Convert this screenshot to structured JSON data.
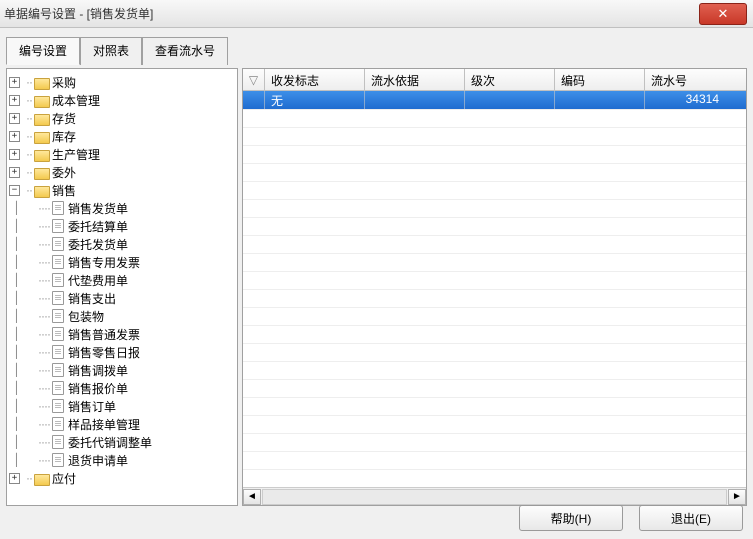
{
  "window": {
    "title": "单据编号设置 - [销售发货单]",
    "close_symbol": "✕"
  },
  "tabs": [
    {
      "label": "编号设置",
      "active": true
    },
    {
      "label": "对照表",
      "active": false
    },
    {
      "label": "查看流水号",
      "active": false
    }
  ],
  "tree": {
    "folders": [
      {
        "label": "采购",
        "expanded": false
      },
      {
        "label": "成本管理",
        "expanded": false
      },
      {
        "label": "存货",
        "expanded": false
      },
      {
        "label": "库存",
        "expanded": false
      },
      {
        "label": "生产管理",
        "expanded": false
      },
      {
        "label": "委外",
        "expanded": false
      },
      {
        "label": "销售",
        "expanded": true
      },
      {
        "label": "应付",
        "expanded": false
      }
    ],
    "sales_children": [
      "销售发货单",
      "委托结算单",
      "委托发货单",
      "销售专用发票",
      "代垫费用单",
      "销售支出",
      "包装物",
      "销售普通发票",
      "销售零售日报",
      "销售调拨单",
      "销售报价单",
      "销售订单",
      "样品接单管理",
      "委托代销调整单",
      "退货申请单"
    ]
  },
  "grid": {
    "columns": [
      "收发标志",
      "流水依据",
      "级次",
      "编码",
      "流水号"
    ],
    "corner": "▽",
    "row": {
      "col0": "无",
      "col1": "",
      "col2": "",
      "col3": "",
      "col4": "34314"
    },
    "scroll": {
      "left": "◄",
      "right": "►"
    }
  },
  "buttons": {
    "help": "帮助(H)",
    "exit": "退出(E)"
  }
}
